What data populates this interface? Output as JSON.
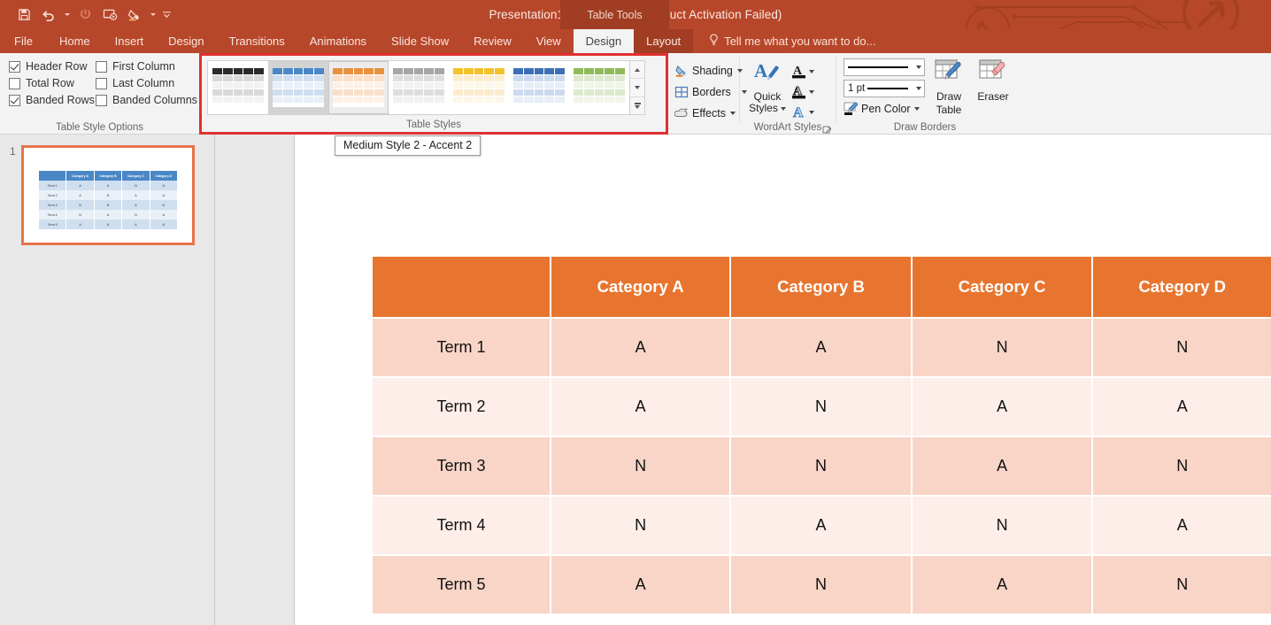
{
  "window": {
    "title": "Presentation1 - PowerPoint (Product Activation Failed)",
    "context_tools": "Table Tools"
  },
  "quick_access": {
    "items": [
      {
        "name": "save-icon",
        "label": "Save"
      },
      {
        "name": "undo-icon",
        "label": "Undo"
      },
      {
        "name": "redo-icon",
        "label": "Repeat"
      },
      {
        "name": "start-slideshow-icon",
        "label": "Start From Beginning"
      },
      {
        "name": "fill-color-icon",
        "label": "Shape Fill"
      },
      {
        "name": "customize-qat-icon",
        "label": "Customize Quick Access Toolbar"
      }
    ]
  },
  "tabs": [
    {
      "label": "File",
      "active": false,
      "contextual": false
    },
    {
      "label": "Home",
      "active": false,
      "contextual": false
    },
    {
      "label": "Insert",
      "active": false,
      "contextual": false
    },
    {
      "label": "Design",
      "active": false,
      "contextual": false
    },
    {
      "label": "Transitions",
      "active": false,
      "contextual": false
    },
    {
      "label": "Animations",
      "active": false,
      "contextual": false
    },
    {
      "label": "Slide Show",
      "active": false,
      "contextual": false
    },
    {
      "label": "Review",
      "active": false,
      "contextual": false
    },
    {
      "label": "View",
      "active": false,
      "contextual": false
    },
    {
      "label": "Design",
      "active": true,
      "contextual": true
    },
    {
      "label": "Layout",
      "active": false,
      "contextual": true
    }
  ],
  "tell_me": {
    "label": "Tell me what you want to do...",
    "icon": "lightbulb-icon"
  },
  "ribbon": {
    "table_style_options": {
      "group_label": "Table Style Options",
      "checkboxes": [
        {
          "label": "Header Row",
          "checked": true
        },
        {
          "label": "First Column",
          "checked": false
        },
        {
          "label": "Total Row",
          "checked": false
        },
        {
          "label": "Last Column",
          "checked": false
        },
        {
          "label": "Banded Rows",
          "checked": true
        },
        {
          "label": "Banded Columns",
          "checked": false
        }
      ]
    },
    "table_styles": {
      "group_label": "Table Styles",
      "highlighted": true,
      "highlight_color": "#e03030",
      "thumbnails": [
        {
          "name": "style-no-style-table-grid",
          "header": "#2b2b2b",
          "band_a": "#d9d9d9",
          "band_b": "#f2f2f2",
          "line": "#404040",
          "state": "normal"
        },
        {
          "name": "style-medium-style-2-accent-1",
          "header": "#4a87c6",
          "band_a": "#cfdff0",
          "band_b": "#e9f0f8",
          "line": "#1f4e79",
          "state": "selected"
        },
        {
          "name": "style-medium-style-2-accent-2",
          "header": "#e8913f",
          "band_a": "#fadfc9",
          "band_b": "#fdf1e7",
          "line": "#8a4b12",
          "state": "hovered"
        },
        {
          "name": "style-medium-style-2-accent-3",
          "header": "#a6a6a6",
          "band_a": "#dedede",
          "band_b": "#f1f1f1",
          "line": "#404040",
          "state": "normal"
        },
        {
          "name": "style-medium-style-2-accent-4",
          "header": "#f2c12b",
          "band_a": "#fbeccd",
          "band_b": "#fdf7e9",
          "line": "#7f6000",
          "state": "normal"
        },
        {
          "name": "style-medium-style-2-accent-5",
          "header": "#3d6fb5",
          "band_a": "#ccdaef",
          "band_b": "#e7eef7",
          "line": "#1f3864",
          "state": "normal"
        },
        {
          "name": "style-medium-style-2-accent-6",
          "header": "#8fba5a",
          "band_a": "#dde9cd",
          "band_b": "#f0f5e8",
          "line": "#375623",
          "state": "normal"
        }
      ],
      "scroll_buttons": [
        "scroll-up",
        "scroll-down",
        "more-styles"
      ]
    },
    "shading_group": {
      "items": [
        {
          "label": "Shading",
          "icon": "shading-bucket-icon"
        },
        {
          "label": "Borders",
          "icon": "borders-grid-icon"
        },
        {
          "label": "Effects",
          "icon": "effects-icon"
        }
      ]
    },
    "wordart_styles": {
      "group_label": "WordArt Styles",
      "quick_styles_label": "Quick\nStyles",
      "quick_styles_line1": "Quick",
      "quick_styles_line2": "Styles",
      "buttons": [
        {
          "name": "text-fill-icon",
          "label": "Text Fill"
        },
        {
          "name": "text-outline-icon",
          "label": "Text Outline"
        },
        {
          "name": "text-effects-icon",
          "label": "Text Effects"
        }
      ],
      "dialog_launcher": "dialog-box-launcher"
    },
    "draw_borders": {
      "group_label": "Draw Borders",
      "pen_style_value": "",
      "pen_weight_value": "1 pt",
      "pen_color_label": "Pen Color",
      "draw_table_line1": "Draw",
      "draw_table_line2": "Table",
      "eraser_label": "Eraser"
    }
  },
  "tooltip": {
    "text": "Medium Style 2 - Accent 2"
  },
  "slide_panel": {
    "slide_number": "1",
    "thumbnail_style": "blue",
    "thumb_header_color": "#4a87c6"
  },
  "slide": {
    "table": {
      "header": [
        "",
        "Category A",
        "Category B",
        "Category C",
        "Category D"
      ],
      "rows": [
        [
          "Term 1",
          "A",
          "A",
          "N",
          "N"
        ],
        [
          "Term 2",
          "A",
          "N",
          "A",
          "A"
        ],
        [
          "Term 3",
          "N",
          "N",
          "A",
          "N"
        ],
        [
          "Term 4",
          "N",
          "A",
          "N",
          "A"
        ],
        [
          "Term 5",
          "A",
          "N",
          "A",
          "N"
        ]
      ],
      "header_color": "#e8752f",
      "band_color_a": "#f8d5c7",
      "band_color_b": "#fdeee9"
    }
  },
  "theme": {
    "accent": "#b7472a",
    "contextual_band": "#a03d23",
    "ribbon_bg": "#f3f3f3"
  }
}
